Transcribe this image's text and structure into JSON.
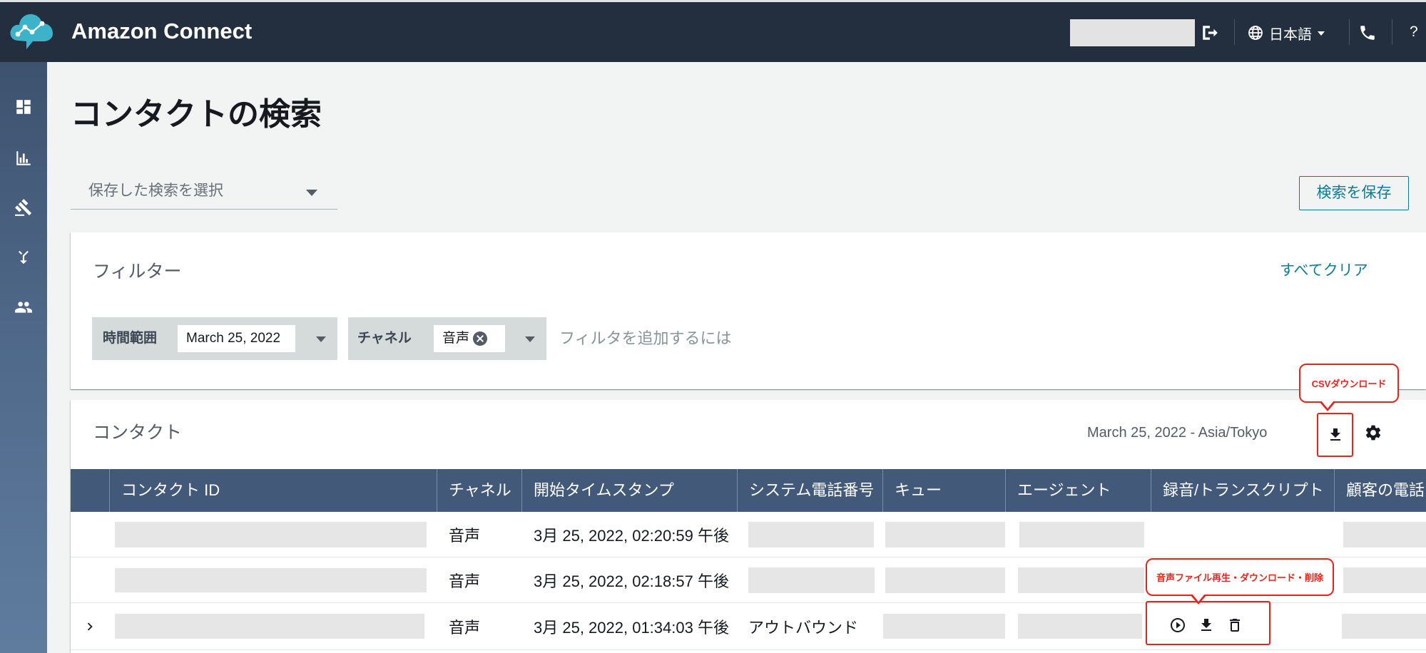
{
  "header": {
    "app_title": "Amazon Connect",
    "language": "日本語",
    "help": "?"
  },
  "sidebar": {
    "items": [
      {
        "icon": "dashboard-icon"
      },
      {
        "icon": "bar-chart-icon"
      },
      {
        "icon": "gavel-icon"
      },
      {
        "icon": "routing-icon"
      },
      {
        "icon": "users-icon"
      }
    ]
  },
  "page": {
    "title": "コンタクトの検索",
    "saved_search_placeholder": "保存した検索を選択",
    "save_search_label": "検索を保存"
  },
  "filters": {
    "title": "フィルター",
    "clear_all_label": "すべてクリア",
    "chips": [
      {
        "label": "時間範囲",
        "value": "March 25, 2022"
      },
      {
        "label": "チャネル",
        "value": "音声"
      }
    ],
    "add_filter_placeholder": "フィルタを追加するには"
  },
  "contacts": {
    "title": "コンタクト",
    "date_range": "March 25, 2022 - Asia/Tokyo",
    "columns": [
      "コンタクト ID",
      "チャネル",
      "開始タイムスタンプ",
      "システム電話番号",
      "キュー",
      "エージェント",
      "録音/トランスクリプト",
      "顧客の電話"
    ],
    "rows": [
      {
        "channel": "音声",
        "start_timestamp": "3月 25, 2022, 02:20:59 午後"
      },
      {
        "channel": "音声",
        "start_timestamp": "3月 25, 2022, 02:18:57 午後"
      },
      {
        "channel": "音声",
        "start_timestamp": "3月 25, 2022, 01:34:03 午後",
        "system_phone": "アウトバウンド",
        "recording_actions": [
          "play-icon",
          "download-icon",
          "delete-icon"
        ]
      }
    ]
  },
  "annotations": {
    "csv_download": "CSVダウンロード",
    "recording_actions": "音声ファイル再生・ダウンロード・削除"
  },
  "colors": {
    "header_bg": "#232f3e",
    "sidebar_bg": "#4f6889",
    "table_header_bg": "#43597a",
    "accent_teal": "#0e7c94",
    "annotation_red": "#e3261c",
    "page_bg": "#f2f3f3"
  }
}
